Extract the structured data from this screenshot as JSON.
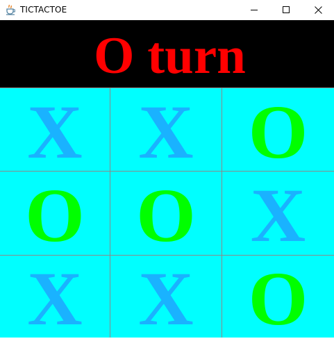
{
  "window": {
    "title": "TICTACTOE",
    "app_icon": "java-cup-icon",
    "controls": [
      "minimize",
      "maximize",
      "close"
    ]
  },
  "status": {
    "text": "O turn",
    "color": "#ff0000",
    "background": "#000000"
  },
  "colors": {
    "board_background": "#00ffff",
    "x_color": "#1ab2ff",
    "o_color": "#00ff00",
    "grid_line": "#8a8a8a"
  },
  "board": {
    "cells": [
      {
        "mark": "X"
      },
      {
        "mark": "X"
      },
      {
        "mark": "O"
      },
      {
        "mark": "O"
      },
      {
        "mark": "O"
      },
      {
        "mark": "X"
      },
      {
        "mark": "X"
      },
      {
        "mark": "X"
      },
      {
        "mark": "O"
      }
    ]
  }
}
